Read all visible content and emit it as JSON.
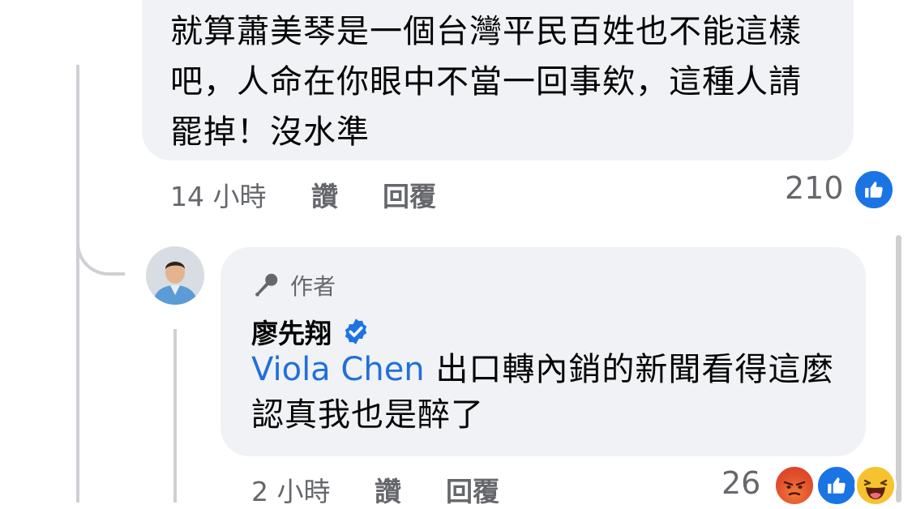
{
  "comment1": {
    "text": "就算蕭美琴是一個台灣平民百姓也不能這樣吧，人命在你眼中不當一回事欸，這種人請罷掉！沒水準",
    "time": "14 小時",
    "like_label": "讚",
    "reply_label": "回覆",
    "reaction_count": "210",
    "reactions": [
      "like-icon"
    ]
  },
  "comment2": {
    "author_badge": "作者",
    "author_name": "廖先翔",
    "verified": true,
    "mention": "Viola Chen",
    "text": " 出口轉內銷的新聞看得這麼認真我也是醉了",
    "time": "2 小時",
    "like_label": "讚",
    "reply_label": "回覆",
    "reaction_count": "26",
    "reactions": [
      "angry-icon",
      "like-icon",
      "haha-icon"
    ]
  },
  "colors": {
    "bubble": "#f0f2f5",
    "meta_text": "#65676b",
    "mention": "#216fdb",
    "like_blue": "#1b74e4",
    "verified_blue": "#1b74e4"
  }
}
